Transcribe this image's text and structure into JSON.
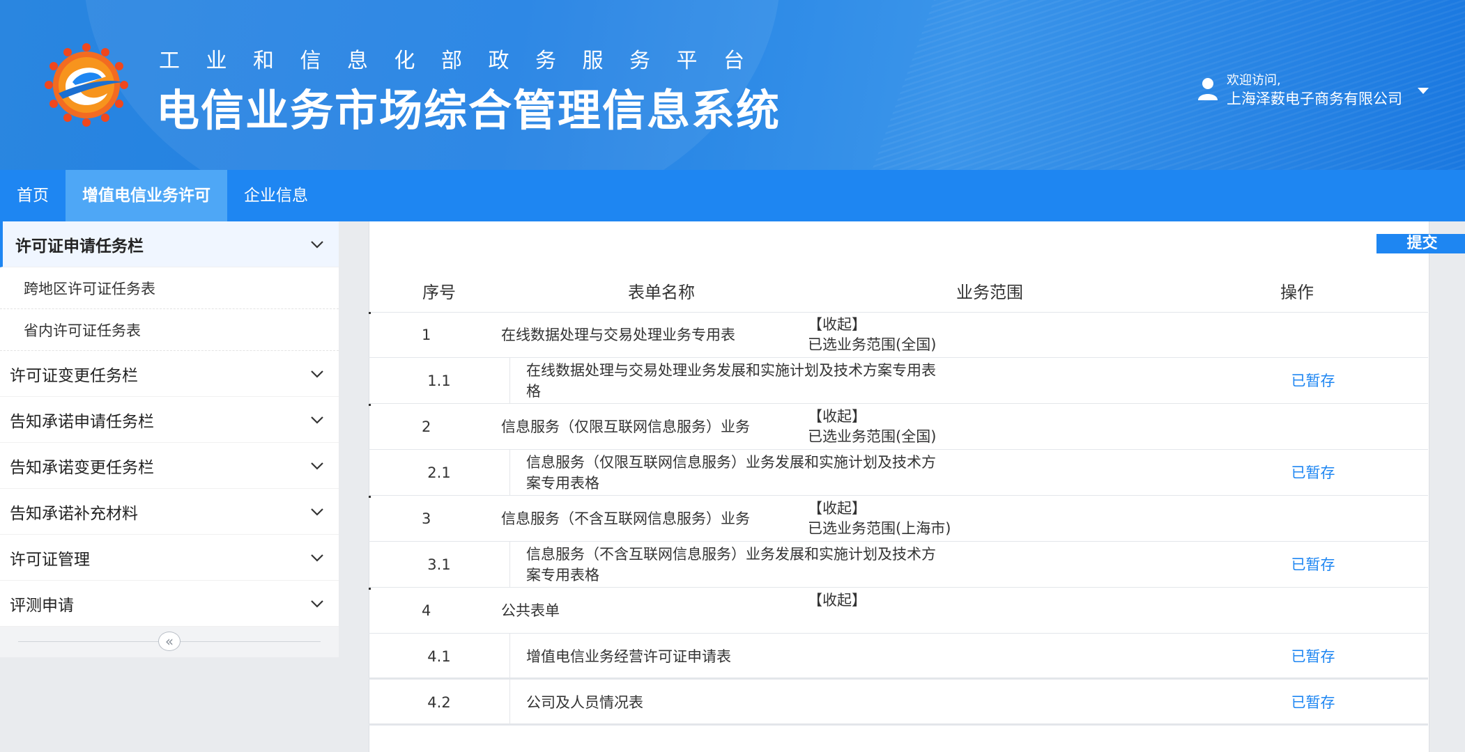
{
  "header": {
    "subtitle_chars": [
      "工",
      "业",
      "和",
      "信",
      "息",
      "化",
      "部",
      "政",
      "务",
      "服",
      "务",
      "平",
      "台"
    ],
    "title": "电信业务市场综合管理信息系统",
    "welcome": "欢迎访问,",
    "company": "上海泽薮电子商务有限公司"
  },
  "nav": {
    "items": [
      {
        "label": "首页"
      },
      {
        "label": "增值电信业务许可"
      },
      {
        "label": "企业信息"
      }
    ]
  },
  "sidebar": {
    "groups": [
      {
        "label": "许可证申请任务栏"
      },
      {
        "label": "许可证变更任务栏"
      },
      {
        "label": "告知承诺申请任务栏"
      },
      {
        "label": "告知承诺变更任务栏"
      },
      {
        "label": "告知承诺补充材料"
      },
      {
        "label": "许可证管理"
      },
      {
        "label": "评测申请"
      }
    ],
    "subitems": [
      {
        "label": "跨地区许可证任务表"
      },
      {
        "label": "省内许可证任务表"
      }
    ],
    "collapse_glyph": "«"
  },
  "main": {
    "submit_label": "提交",
    "columns": [
      "序号",
      "表单名称",
      "业务范围",
      "操作"
    ],
    "collapse_label": "【收起】",
    "saved_label": "已暂存",
    "rows": [
      {
        "no": "1",
        "name": "在线数据处理与交易处理业务专用表",
        "scope": "已选业务范围(全国)"
      },
      {
        "no": "1.1",
        "name": "在线数据处理与交易处理业务发展和实施计划及技术方案专用表格"
      },
      {
        "no": "2",
        "name": "信息服务（仅限互联网信息服务）业务",
        "scope": "已选业务范围(全国)"
      },
      {
        "no": "2.1",
        "name": "信息服务（仅限互联网信息服务）业务发展和实施计划及技术方案专用表格"
      },
      {
        "no": "3",
        "name": "信息服务（不含互联网信息服务）业务",
        "scope": "已选业务范围(上海市)"
      },
      {
        "no": "3.1",
        "name": "信息服务（不含互联网信息服务）业务发展和实施计划及技术方案专用表格"
      },
      {
        "no": "4",
        "name": "公共表单"
      },
      {
        "no": "4.1",
        "name": "增值电信业务经营许可证申请表"
      },
      {
        "no": "4.2",
        "name": "公司及人员情况表"
      }
    ]
  },
  "colors": {
    "accent": "#1e86f2",
    "nav_active": "#4ea7f6"
  }
}
